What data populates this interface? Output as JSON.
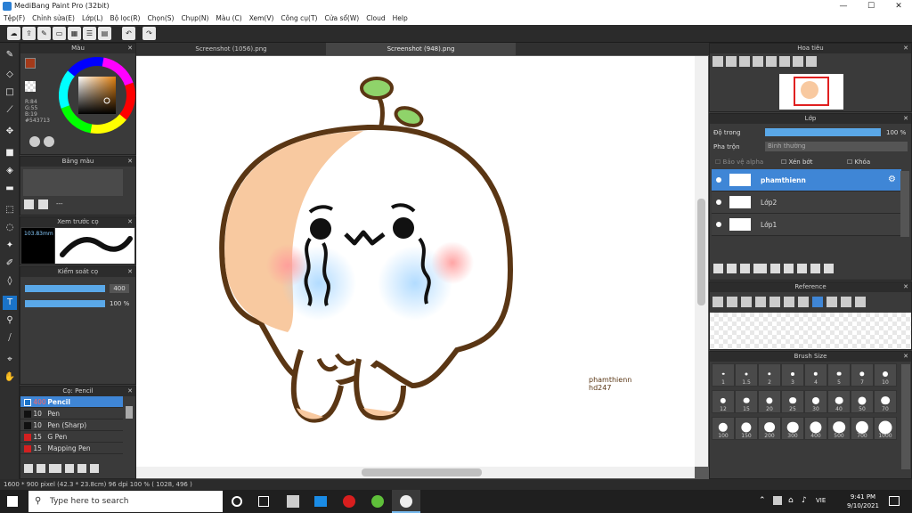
{
  "app": {
    "title": "MediBang Paint Pro (32bit)"
  },
  "window_controls": {
    "minimize": "—",
    "maximize": "☐",
    "close": "✕"
  },
  "menu": [
    "Tệp(F)",
    "Chỉnh sửa(E)",
    "Lớp(L)",
    "Bộ lọc(R)",
    "Chọn(S)",
    "Chụp(N)",
    "Màu (C)",
    "Xem(V)",
    "Công cụ(T)",
    "Cửa sổ(W)",
    "Cloud",
    "Help"
  ],
  "tabs": [
    {
      "label": "Screenshot (1056).png"
    },
    {
      "label": "Screenshot (948).png"
    }
  ],
  "color_panel": {
    "title": "Màu",
    "r": "R:84",
    "g": "G:55",
    "b": "B:19",
    "hex": "#543713",
    "fg": "#a33a1a",
    "bg": "#ffffff"
  },
  "palette_panel": {
    "title": "Bảng màu",
    "value": "---"
  },
  "brush_preview": {
    "title": "Xem trước cọ",
    "size": "103.83mm"
  },
  "brush_control": {
    "title": "Kiểm soát cọ",
    "size_value": "400",
    "opacity_value": "100 %"
  },
  "brush_list": {
    "title": "Cọ: Pencil",
    "items": [
      {
        "size": "400",
        "name": "Pencil",
        "color": "#1a73c8"
      },
      {
        "size": "10",
        "name": "Pen",
        "color": "#111111"
      },
      {
        "size": "10",
        "name": "Pen (Sharp)",
        "color": "#111111"
      },
      {
        "size": "15",
        "name": "G Pen",
        "color": "#d32020"
      },
      {
        "size": "15",
        "name": "Mapping Pen",
        "color": "#d32020"
      }
    ]
  },
  "navigator": {
    "title": "Hoa tiêu"
  },
  "layer_panel": {
    "title": "Lớp",
    "opacity_label": "Độ trong",
    "opacity_value": "100 %",
    "blend_label": "Pha trộn",
    "blend_value": "Bình thường",
    "protect_alpha": "Bảo vệ alpha",
    "clipping": "Xén bớt",
    "lock": "Khóa",
    "layers": [
      {
        "name": "phamthienn",
        "selected": true
      },
      {
        "name": "Lớp2",
        "selected": false
      },
      {
        "name": "Lớp1",
        "selected": false
      }
    ]
  },
  "reference_panel": {
    "title": "Reference"
  },
  "brush_size_panel": {
    "title": "Brush Size",
    "sizes": [
      "1",
      "1.5",
      "2",
      "3",
      "4",
      "5",
      "7",
      "10",
      "12",
      "15",
      "20",
      "25",
      "30",
      "40",
      "50",
      "70",
      "100",
      "150",
      "200",
      "300",
      "400",
      "500",
      "700",
      "1000"
    ]
  },
  "artwork": {
    "signature_line1": "phamthienn",
    "signature_line2": "hd247"
  },
  "status": {
    "text": "1600 * 900 pixel  (42.3 * 23.8cm)  96 dpi  100 %  ( 1028, 496 )"
  },
  "taskbar": {
    "search_placeholder": "Type here to search",
    "time": "9:41 PM",
    "date": "9/10/2021",
    "lang": "VIE"
  }
}
